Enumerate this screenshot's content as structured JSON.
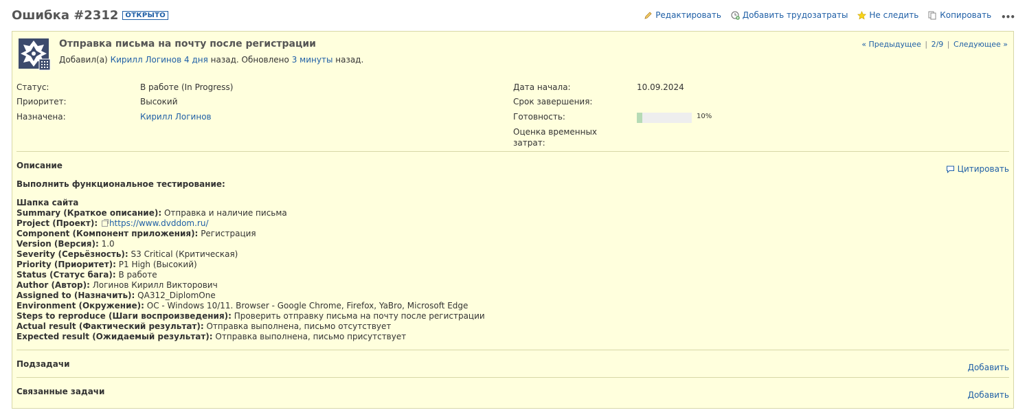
{
  "header": {
    "title": "Ошибка #2312",
    "badge": "ОТКРЫТО",
    "actions": [
      {
        "label": "Редактировать",
        "icon": "pencil-icon"
      },
      {
        "label": "Добавить трудозатраты",
        "icon": "clock-add-icon"
      },
      {
        "label": "Не следить",
        "icon": "star-icon"
      },
      {
        "label": "Копировать",
        "icon": "copy-icon"
      }
    ],
    "more": "•••"
  },
  "issue": {
    "subject": "Отправка письма на почту после регистрации",
    "added_prefix": "Добавил(а)",
    "author": "Кирилл Логинов",
    "added_ago": "4 дня",
    "added_suffix": "назад. Обновлено",
    "updated_ago": "3 минуты",
    "updated_suffix": "назад.",
    "nav": {
      "prev": "« Предыдущее",
      "sep1": "|",
      "pos": "2/9",
      "sep2": "|",
      "next": "Следующее »"
    }
  },
  "attributes": {
    "status": {
      "label": "Статус:",
      "value": "В работе (In Progress)"
    },
    "priority": {
      "label": "Приоритет:",
      "value": "Высокий"
    },
    "assigned": {
      "label": "Назначена:",
      "value": "Кирилл Логинов"
    },
    "start_date": {
      "label": "Дата начала:",
      "value": "10.09.2024"
    },
    "due_date": {
      "label": "Срок завершения:",
      "value": ""
    },
    "done": {
      "label": "Готовность:",
      "value": "10%",
      "fraction": 0.1
    },
    "estimate": {
      "label_line1": "Оценка временных",
      "label_line2": "затрат:",
      "value": ""
    }
  },
  "description": {
    "title": "Описание",
    "quote": "Цитировать",
    "heading": "Выполнить функциональное тестирование:",
    "subheading": "Шапка сайта",
    "lines": [
      {
        "k": "Summary (Краткое описание):",
        "v": "Отправка и наличие письма"
      },
      {
        "k": "Project (Проект):",
        "v": "https://www.dvddom.ru/",
        "link": true
      },
      {
        "k": "Component (Компонент приложения):",
        "v": "Регистрация"
      },
      {
        "k": "Version (Версия):",
        "v": "1.0"
      },
      {
        "k": "Severity (Серьёзность):",
        "v": "S3 Critical (Критическая)"
      },
      {
        "k": "Priority (Приоритет):",
        "v": "P1 High (Высокий)"
      },
      {
        "k": "Status (Статус бага):",
        "v": "В работе"
      },
      {
        "k": "Author (Автор):",
        "v": "Логинов Кирилл Викторович"
      },
      {
        "k": "Assigned to (Назначить):",
        "v": "QA312_DiplomOne"
      },
      {
        "k": "Environment (Окружение):",
        "v": "ОС - Windows 10/11. Browser - Google Chrome, Firefox, YaBro, Microsoft Edge"
      },
      {
        "k": "Steps to reproduce (Шаги воспроизведения):",
        "v": "Проверить отправку письма на почту после регистрации"
      },
      {
        "k": "Actual result (Фактический результат):",
        "v": "Отправка выполнена, письмо отсутствует"
      },
      {
        "k": "Expected result (Ожидаемый результат):",
        "v": "Отправка выполнена, письмо присутствует"
      }
    ]
  },
  "subtasks": {
    "title": "Подзадачи",
    "add": "Добавить"
  },
  "related": {
    "title": "Связанные задачи",
    "add": "Добавить"
  },
  "colors": {
    "panel_bg": "#ffffdd",
    "link": "#1f5fa6",
    "progress_fill": "#b6dbb5"
  }
}
